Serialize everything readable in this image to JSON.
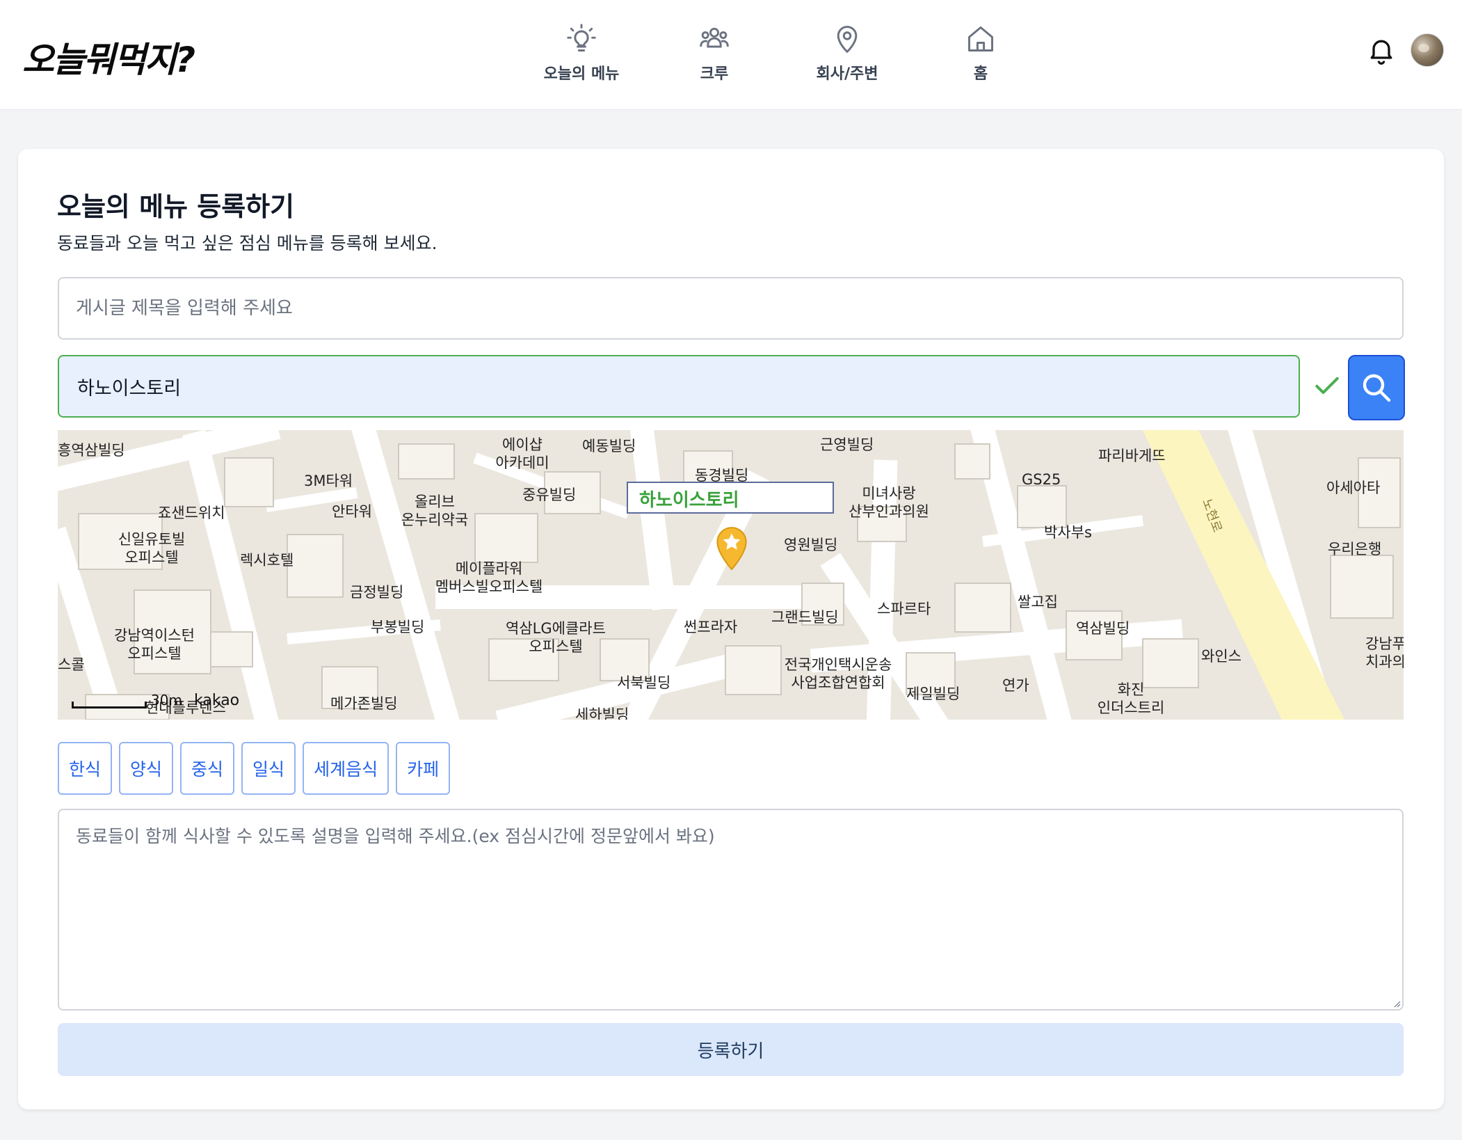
{
  "header": {
    "logo": "오늘뭐먹지?",
    "nav": [
      {
        "label": "오늘의 메뉴",
        "icon": "lightbulb-icon"
      },
      {
        "label": "크루",
        "icon": "users-icon"
      },
      {
        "label": "회사/주변",
        "icon": "map-pin-icon"
      },
      {
        "label": "홈",
        "icon": "home-icon"
      }
    ],
    "notification_icon": "bell-icon",
    "avatar": "user-avatar"
  },
  "form": {
    "title": "오늘의 메뉴 등록하기",
    "description": "동료들과 오늘 먹고 싶은 점심 메뉴를 등록해 보세요.",
    "post_title_placeholder": "게시글 제목을 입력해 주세요",
    "post_title_value": "",
    "place_value": "하노이스토리",
    "place_valid": true,
    "search_icon": "search-icon",
    "categories": [
      "한식",
      "양식",
      "중식",
      "일식",
      "세계음식",
      "카페"
    ],
    "description_placeholder": "동료들이 함께 식사할 수 있도록 설명을 입력해 주세요.(ex 점심시간에 정문앞에서 봐요)",
    "submit_label": "등록하기"
  },
  "map": {
    "selected_place": "하노이스토리",
    "scale_text": "30m",
    "attribution": "kakao",
    "labels": [
      "흥역삼빌딩",
      "에이샵\n아카데미",
      "예동빌딩",
      "근영빌딩",
      "파리바게뜨",
      "3M타워",
      "동경빌딩",
      "GS25",
      "아세아타",
      "죠샌드위치",
      "안타워",
      "올리브\n온누리약국",
      "중유빌딩",
      "미녀사랑\n산부인과의원",
      "박사부s",
      "신일유토빌\n오피스텔",
      "렉시호텔",
      "영원빌딩",
      "우리은행",
      "메이플라워\n멤버스빌오피스텔",
      "금정빌딩",
      "스파르타",
      "쌀고집",
      "부봉빌딩",
      "역삼LG에클라트\n오피스텔",
      "썬프라자",
      "그랜드빌딩",
      "역삼빌딩",
      "강남역이스턴\n오피스텔",
      "와인스",
      "강남푸른\n치과의원",
      "전국개인택시운송\n사업조합연합회",
      "제일빌딩",
      "연가",
      "화진\n인더스트리",
      "서북빌딩",
      "메가존빌딩",
      "현대플루텐스",
      "세하빌딩",
      "스콜",
      "노현로"
    ]
  }
}
